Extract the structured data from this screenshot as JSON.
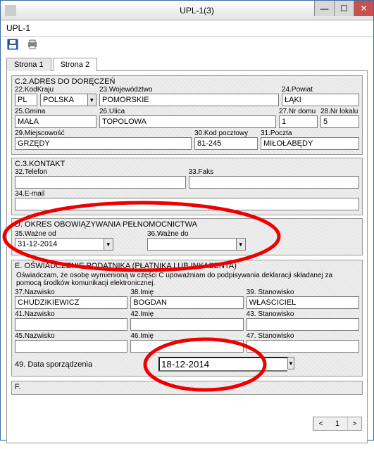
{
  "window": {
    "title": "UPL-1(3)",
    "subtitle": "UPL-1"
  },
  "tabs": {
    "page1": "Strona 1",
    "page2": "Strona 2"
  },
  "c2": {
    "title": "C.2.ADRES DO DORĘCZEŃ",
    "l22": "22.KodKraju",
    "l23": "23.Województwo",
    "l24": "24.Powiat",
    "v22a": "PL",
    "v22b": "POLSKA",
    "v23": "POMORSKIE",
    "v24": "ŁĄKI",
    "l25": "25.Gmina",
    "l26": "26.Ulica",
    "l27": "27.Nr domu",
    "l28": "28.Nr lokalu",
    "v25": "MAŁA",
    "v26": "TOPOLOWA",
    "v27": "1",
    "v28": "5",
    "l29": "29.Miejscowość",
    "l30": "30.Kod pocztowy",
    "l31": "31.Poczta",
    "v29": "GRZĘDY",
    "v30": "81-245",
    "v31": "MIŁOŁABĘDY"
  },
  "c3": {
    "title": "C.3.KONTAKT",
    "l32": "32.Telefon",
    "l33": "33.Faks",
    "l34": "34.E-mail",
    "v32": "",
    "v33": "",
    "v34": ""
  },
  "d": {
    "title": "D. OKRES OBOWIĄZYWANIA PEŁNOMOCNICTWA",
    "l35": "35.Ważne od",
    "l36": "36.Ważne do",
    "v35": "31-12-2014",
    "v36": ""
  },
  "e": {
    "title": "E. OŚWIADCZENIE PODATNIKA (PŁATNIKA LUB INKASENTA)",
    "desc": "Oświadczam, że osobę wymienioną w części C upoważniam do podpisywania deklaracji składanej za pomocą środków komunikacji elektronicznej.",
    "l37": "37.Nazwisko",
    "l38": "38.Imię",
    "l39": "39. Stanowisko",
    "v37": "CHUDZIKIEWICZ",
    "v38": "BOGDAN",
    "v39": "WŁAŚCICIEL",
    "l41": "41.Nazwisko",
    "l42": "42.Imię",
    "l43": "43. Stanowisko",
    "v41": "",
    "v42": "",
    "v43": "",
    "l45": "45.Nazwisko",
    "l46": "46.Imię",
    "l47": "47. Stanowisko",
    "v45": "",
    "v46": "",
    "v47": "",
    "l49": "49. Data sporządzenia",
    "v49": "18-12-2014"
  },
  "f": {
    "title": "F."
  },
  "pager": {
    "page": "1"
  }
}
